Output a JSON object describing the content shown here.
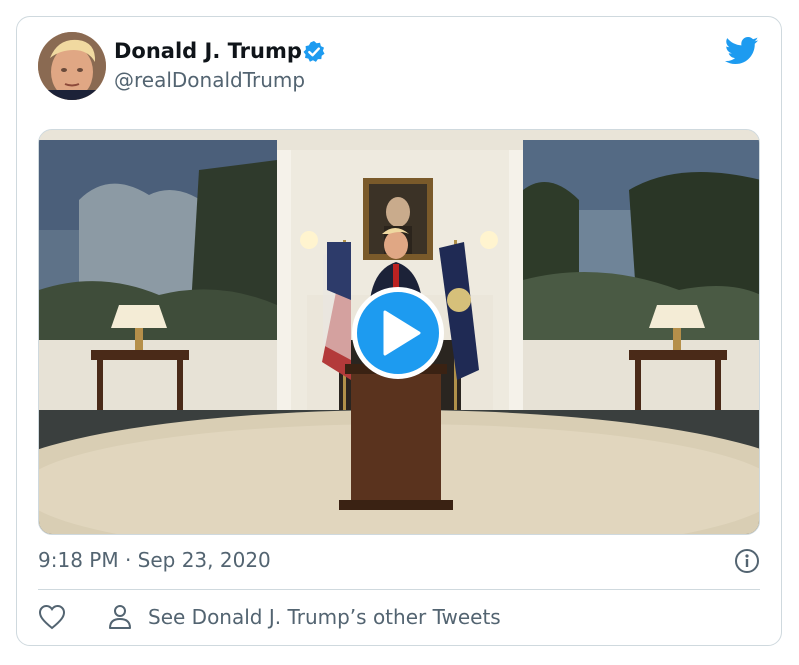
{
  "tweet": {
    "author_name": "Donald J. Trump",
    "handle": "@realDonaldTrump",
    "timestamp": "9:18 PM · Sep 23, 2020",
    "other_tweets_label": "See Donald J. Trump’s other Tweets"
  },
  "icons": {
    "verified": "verified-badge-icon",
    "brand": "twitter-bird-icon",
    "play": "play-icon",
    "info": "info-icon",
    "like": "heart-icon",
    "person": "person-icon"
  },
  "colors": {
    "brand": "#1d9bf0",
    "text_primary": "#0f1419",
    "text_secondary": "#536471",
    "border": "#cfd9de"
  }
}
